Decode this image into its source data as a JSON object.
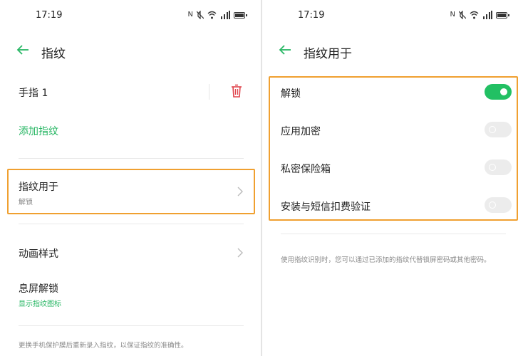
{
  "colors": {
    "accent_green": "#29b765",
    "highlight": "#f0a030",
    "delete_red": "#e0454d"
  },
  "left": {
    "status": {
      "time": "17:19"
    },
    "header": {
      "title": "指纹",
      "back_icon": "arrow-left-icon"
    },
    "finger_label": "手指 1",
    "add_fingerprint": "添加指纹",
    "fingerprint_for": {
      "label": "指纹用于",
      "value": "解锁"
    },
    "animation_style": "动画样式",
    "screen_off_unlock": {
      "label": "息屏解锁",
      "sub": "显示指纹图标"
    },
    "footnote": "更换手机保护膜后重新录入指纹，以保证指纹的准确性。"
  },
  "right": {
    "status": {
      "time": "17:19"
    },
    "header": {
      "title": "指纹用于",
      "back_icon": "arrow-left-icon"
    },
    "options": [
      {
        "label": "解锁",
        "enabled": true
      },
      {
        "label": "应用加密",
        "enabled": false
      },
      {
        "label": "私密保险箱",
        "enabled": false
      },
      {
        "label": "安装与短信扣费验证",
        "enabled": false
      }
    ],
    "footnote": "使用指纹识别时，您可以通过已添加的指纹代替锁屏密码或其他密码。"
  }
}
